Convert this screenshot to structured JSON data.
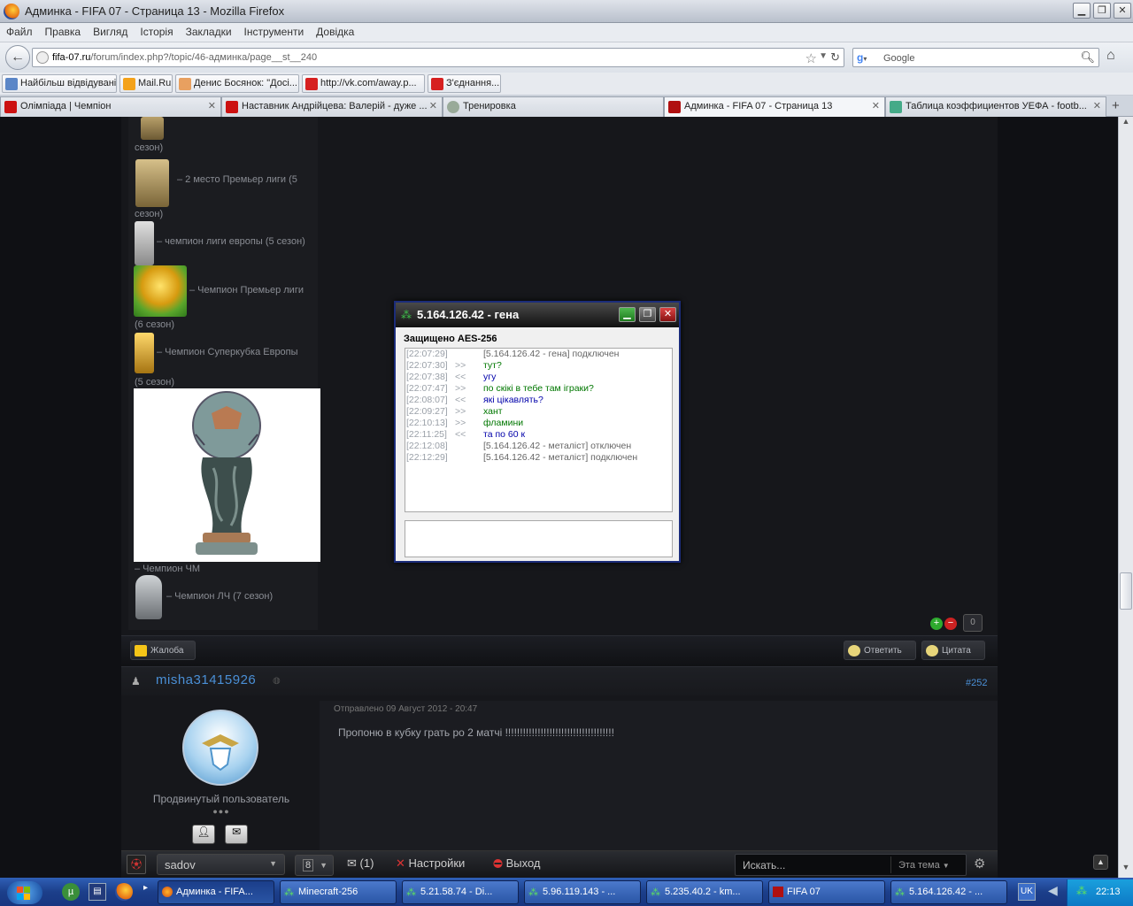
{
  "window": {
    "title": "Админка - FIFA 07 - Страница 13 - Mozilla Firefox"
  },
  "menu": [
    "Файл",
    "Правка",
    "Вигляд",
    "Історія",
    "Закладки",
    "Інструменти",
    "Довідка"
  ],
  "url": {
    "domain": "fifa-07.ru",
    "path": "/forum/index.php?/topic/46-админка/page__st__240"
  },
  "search": {
    "placeholder": "Google"
  },
  "bookmarks": [
    "Найбільш відвідувані",
    "Mail.Ru",
    "Денис Босянок: \"Досі...",
    "http://vk.com/away.p...",
    "З'єднання..."
  ],
  "tabs": [
    {
      "label": "Олімпіада | Чемпіон",
      "active": false
    },
    {
      "label": "Наставник Андрійцева: Валерій - дуже ...",
      "active": false
    },
    {
      "label": "Тренировка",
      "active": false
    },
    {
      "label": "Админка - FIFA 07 - Страница 13",
      "active": true
    },
    {
      "label": "Таблица коэффициентов УЕФА - footb...",
      "active": false
    }
  ],
  "awards": [
    {
      "text": "сезон)"
    },
    {
      "text": "– 2 место Премьер лиги (5"
    },
    {
      "text": "сезон)"
    },
    {
      "text": "– чемпион лиги европы (5 сезон)"
    },
    {
      "text": "– Чемпион Премьер лиги"
    },
    {
      "text": "(6 сезон)"
    },
    {
      "text": "– Чемпион Суперкубка Европы"
    },
    {
      "text": "(5 сезон)"
    },
    {
      "text": "– Чемпион ЧМ"
    },
    {
      "text": "– Чемпион ЛЧ (7 сезон)"
    }
  ],
  "post_actions": {
    "rep_count": "0",
    "report": "Жалоба",
    "reply": "Ответить",
    "quote": "Цитата"
  },
  "post": {
    "author": "misha31415926",
    "number": "#252",
    "date": "Отправлено 09 Август 2012 - 20:47",
    "text": "Пропоню в кубку грать ро 2 матчі !!!!!!!!!!!!!!!!!!!!!!!!!!!!!!!!!!!!!",
    "rank": "Продвинутый пользователь",
    "dots": "●●●"
  },
  "chat": {
    "title": "5.164.126.42 - гена",
    "encryption": "Защищено AES-256",
    "log": [
      {
        "time": "[22:07:29]",
        "dir": "",
        "msg": "[5.164.126.42 - гена] подключен",
        "kind": "sys"
      },
      {
        "time": "[22:07:30]",
        "dir": ">>",
        "msg": "тут?",
        "kind": "out"
      },
      {
        "time": "[22:07:38]",
        "dir": "<<",
        "msg": "угу",
        "kind": "in"
      },
      {
        "time": "[22:07:47]",
        "dir": ">>",
        "msg": "по скікі в тебе там іграки?",
        "kind": "out"
      },
      {
        "time": "[22:08:07]",
        "dir": "<<",
        "msg": "які цікавлять?",
        "kind": "in"
      },
      {
        "time": "[22:09:27]",
        "dir": ">>",
        "msg": "хант",
        "kind": "out"
      },
      {
        "time": "[22:10:13]",
        "dir": ">>",
        "msg": "фламини",
        "kind": "out"
      },
      {
        "time": "[22:11:25]",
        "dir": "<<",
        "msg": "та по 60 к",
        "kind": "in"
      },
      {
        "time": "[22:12:08]",
        "dir": "",
        "msg": "[5.164.126.42 - металіст] отключен",
        "kind": "sys"
      },
      {
        "time": "[22:12:29]",
        "dir": "",
        "msg": "[5.164.126.42 - металіст] подключен",
        "kind": "sys"
      }
    ]
  },
  "bottombar": {
    "user": "sadov",
    "count": "8",
    "messages": "(1)",
    "settings": "Настройки",
    "logout": "Выход",
    "search_placeholder": "Искать...",
    "scope": "Эта тема"
  },
  "taskbar": {
    "items": [
      {
        "label": "Админка - FIFA..."
      },
      {
        "label": "Minecraft-256"
      },
      {
        "label": "5.21.58.74 - Di..."
      },
      {
        "label": "5.96.119.143 - ..."
      },
      {
        "label": "5.235.40.2 - km..."
      },
      {
        "label": "FIFA 07"
      },
      {
        "label": "5.164.126.42 - ..."
      }
    ],
    "lang": "UK",
    "clock": "22:13"
  },
  "colors": {
    "chat_out": "#007700",
    "chat_in": "#0000aa",
    "chat_sys": "#666666",
    "link": "#4a8fd6"
  }
}
